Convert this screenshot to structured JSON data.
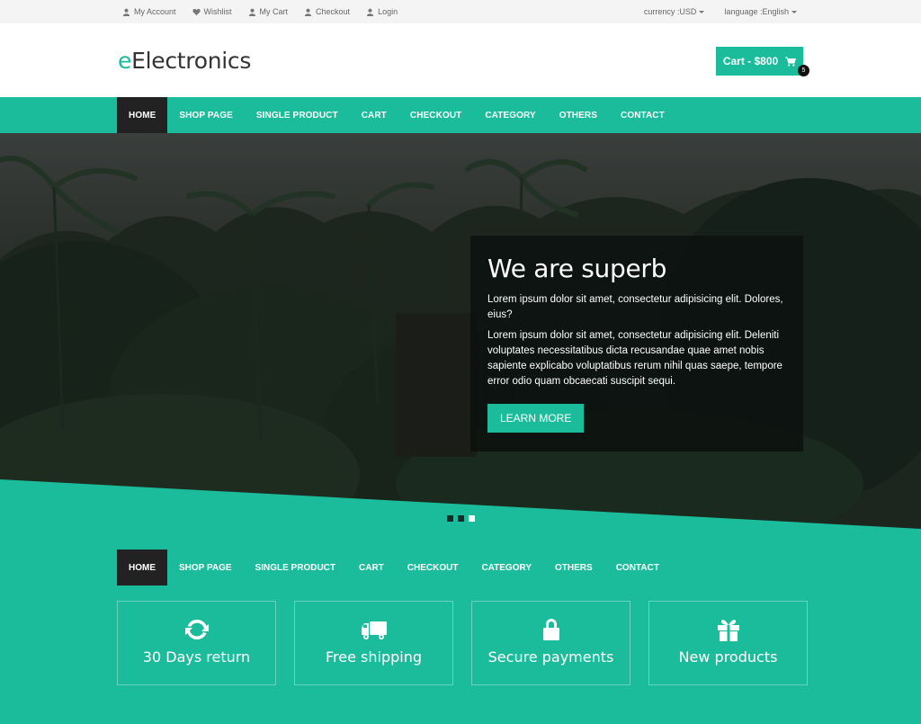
{
  "topbar": {
    "links": [
      {
        "label": "My Account",
        "icon": "user-icon"
      },
      {
        "label": "Wishlist",
        "icon": "heart-icon"
      },
      {
        "label": "My Cart",
        "icon": "user-icon"
      },
      {
        "label": "Checkout",
        "icon": "user-icon"
      },
      {
        "label": "Login",
        "icon": "user-icon"
      }
    ],
    "currency": "currency :USD",
    "language": "language :English"
  },
  "header": {
    "logo_prefix": "e",
    "logo_rest": "Electronics",
    "cart_label": "Cart - $800",
    "cart_count": "5"
  },
  "nav": {
    "items": [
      "HOME",
      "SHOP PAGE",
      "SINGLE PRODUCT",
      "CART",
      "CHECKOUT",
      "CATEGORY",
      "OTHERS",
      "CONTACT"
    ],
    "active": "HOME"
  },
  "hero": {
    "title": "We are superb",
    "paragraph1": "Lorem ipsum dolor sit amet, consectetur adipisicing elit. Dolores, eius?",
    "paragraph2": "Lorem ipsum dolor sit amet, consectetur adipisicing elit. Deleniti voluptates necessitatibus dicta recusandae quae amet nobis sapiente explicabo voluptatibus rerum nihil quas saepe, tempore error odio quam obcaecati suscipit sequi.",
    "button": "LEARN MORE",
    "slides": 3,
    "active_slide": 3
  },
  "features": [
    {
      "label": "30 Days return",
      "icon": "refresh-icon"
    },
    {
      "label": "Free shipping",
      "icon": "truck-icon"
    },
    {
      "label": "Secure payments",
      "icon": "lock-icon"
    },
    {
      "label": "New products",
      "icon": "gift-icon"
    }
  ],
  "colors": {
    "accent": "#1abc9c",
    "dark": "#222222",
    "topbar_bg": "#f4f4f4"
  }
}
